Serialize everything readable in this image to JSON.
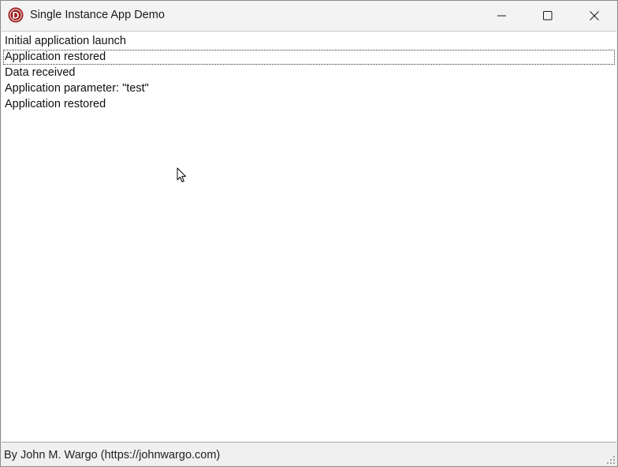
{
  "window": {
    "title": "Single Instance App Demo",
    "controls": {
      "minimize": "minimize",
      "maximize": "maximize",
      "close": "close"
    }
  },
  "log": {
    "items": [
      "Initial application launch",
      "Application restored",
      "Data received",
      "Application parameter: \"test\"",
      "Application restored"
    ],
    "focused_index": 1
  },
  "statusbar": {
    "text": "By John M. Wargo (https://johnwargo.com)"
  },
  "colors": {
    "icon_red": "#9b1b1b",
    "title_bg": "#f3f3f3",
    "list_bg": "#ffffff"
  },
  "icons": [
    "app-icon",
    "minimize-icon",
    "maximize-icon",
    "close-icon",
    "mouse-cursor-icon",
    "resize-grip-icon"
  ]
}
